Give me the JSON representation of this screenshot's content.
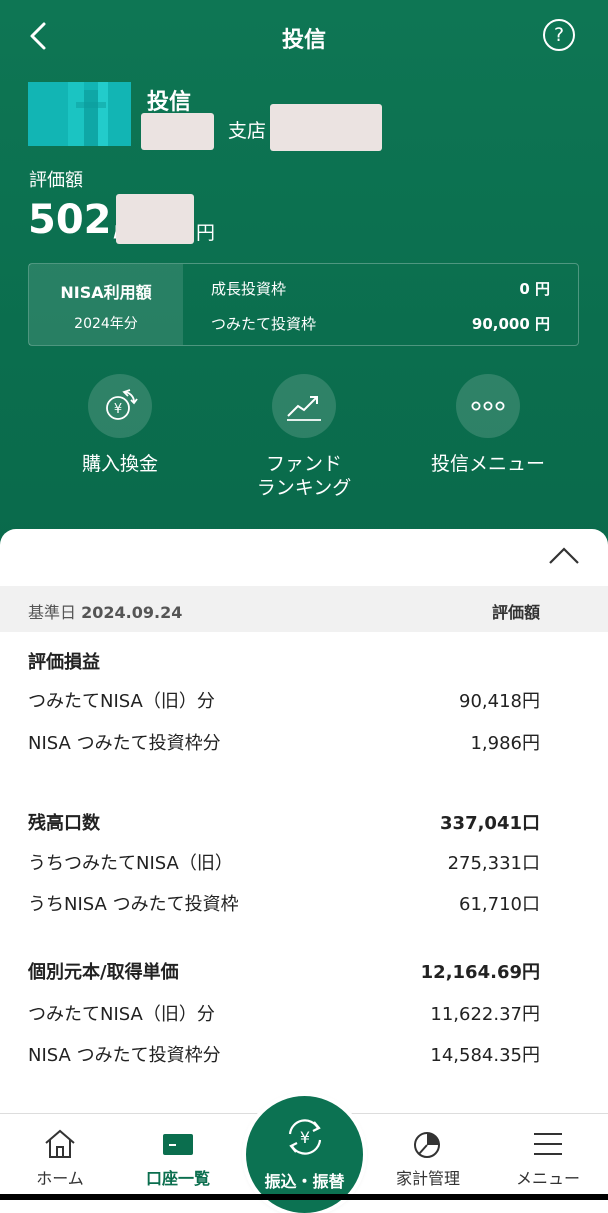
{
  "header": {
    "title": "投信",
    "help_glyph": "?",
    "fund_name": "投信",
    "branch_label": "支店",
    "eval_label": "評価額",
    "eval_amount_visible": "502,",
    "eval_unit": "円"
  },
  "nisa": {
    "title": "NISA利用額",
    "year": "2024年分",
    "rows": [
      {
        "label": "成長投資枠",
        "value": "0 円"
      },
      {
        "label": "つみたて投資枠",
        "value": "90,000 円"
      }
    ]
  },
  "actions": [
    {
      "label": "購入換金",
      "icon": "yen-exchange-icon"
    },
    {
      "label": "ファンド\nランキング",
      "icon": "trend-chart-icon"
    },
    {
      "label": "投信メニュー",
      "icon": "more-dots-icon"
    }
  ],
  "details": {
    "date_label": "基準日",
    "date_value": "2024.09.24",
    "column_header": "評価額",
    "sections": [
      {
        "title": "評価損益",
        "title_value": "",
        "rows": [
          {
            "label": "つみたてNISA（旧）分",
            "value": "90,418円"
          },
          {
            "label": "NISA つみたて投資枠分",
            "value": "1,986円"
          }
        ]
      },
      {
        "title": "残高口数",
        "title_value": "337,041口",
        "rows": [
          {
            "label": "うちつみたてNISA（旧）",
            "value": "275,331口"
          },
          {
            "label": "うちNISA つみたて投資枠",
            "value": "61,710口"
          }
        ]
      },
      {
        "title": "個別元本/取得単価",
        "title_value": "12,164.69円",
        "rows": [
          {
            "label": "つみたてNISA（旧）分",
            "value": "11,622.37円"
          },
          {
            "label": "NISA つみたて投資枠分",
            "value": "14,584.35円"
          }
        ]
      }
    ]
  },
  "tabbar": {
    "items": [
      {
        "label": "ホーム",
        "icon": "home-icon"
      },
      {
        "label": "口座一覧",
        "icon": "card-icon"
      },
      {
        "label": "振込・振替",
        "icon": "yen-transfer-icon"
      },
      {
        "label": "家計管理",
        "icon": "pie-chart-icon"
      },
      {
        "label": "メニュー",
        "icon": "hamburger-icon"
      }
    ],
    "active_index": 1
  },
  "colors": {
    "brand_green": "#0b6e4e",
    "thumb_teal": "#12b5b4",
    "mask": "#ebe3e1"
  }
}
